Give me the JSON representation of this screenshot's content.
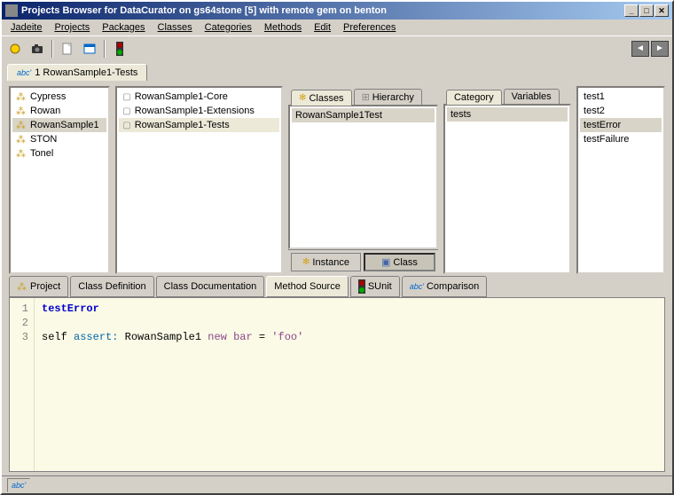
{
  "window": {
    "title": "Projects Browser for DataCurator on gs64stone [5] with remote gem on benton"
  },
  "menu": {
    "items": [
      "Jadeite",
      "Projects",
      "Packages",
      "Classes",
      "Categories",
      "Methods",
      "Edit",
      "Preferences"
    ]
  },
  "topTab": {
    "label": "1 RowanSample1-Tests"
  },
  "projects": {
    "items": [
      "Cypress",
      "Rowan",
      "RowanSample1",
      "STON",
      "Tonel"
    ],
    "selected": "RowanSample1"
  },
  "packages": {
    "items": [
      "RowanSample1-Core",
      "RowanSample1-Extensions",
      "RowanSample1-Tests"
    ],
    "selected": "RowanSample1-Tests"
  },
  "classPane": {
    "tabs": [
      "Classes",
      "Hierarchy"
    ],
    "active": "Classes",
    "items": [
      "RowanSample1Test"
    ],
    "selected": "RowanSample1Test",
    "footer": {
      "instance": "Instance",
      "classBtn": "Class",
      "active": "Class"
    }
  },
  "categoryPane": {
    "tabs": [
      "Category",
      "Variables"
    ],
    "active": "Category",
    "items": [
      "tests"
    ],
    "selected": "tests"
  },
  "methods": {
    "items": [
      "test1",
      "test2",
      "testError",
      "testFailure"
    ],
    "selected": "testError"
  },
  "bottomTabs": {
    "items": [
      "Project",
      "Class Definition",
      "Class Documentation",
      "Method Source",
      "SUnit",
      "Comparison"
    ],
    "active": "Method Source"
  },
  "editor": {
    "lines": [
      {
        "n": "1",
        "methodName": "testError"
      },
      {
        "n": "2"
      },
      {
        "n": "3",
        "indent": "    ",
        "self": "self ",
        "assert": "assert:",
        "rest": " RowanSample1 ",
        "msg": "new bar",
        "eq": " = ",
        "str": "'foo'"
      }
    ]
  },
  "status": {
    "abc": "abc'"
  }
}
